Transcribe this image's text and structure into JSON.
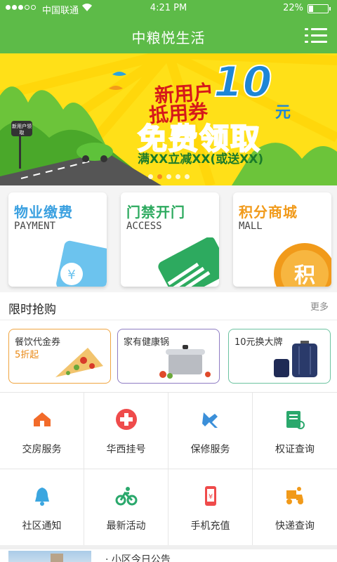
{
  "status_bar": {
    "carrier": "中国联通",
    "time": "4:21 PM",
    "battery": "22%",
    "battery_level": 0.22
  },
  "header": {
    "title": "中粮悦生活",
    "menu_icon": "menu-icon"
  },
  "banner": {
    "line1": "新用户",
    "line2": "抵用券",
    "amount": "10",
    "unit": "元",
    "big": "免费领取",
    "small": "满XX立减XX(或送XX)",
    "sign": "新用户领取",
    "dots": 5,
    "active_dot": 1
  },
  "features": [
    {
      "zh": "物业缴费",
      "en": "PAYMENT",
      "color": "#3aa0e0"
    },
    {
      "zh": "门禁开门",
      "en": "ACCESS",
      "color": "#2daa5f"
    },
    {
      "zh": "积分商城",
      "en": "MALL",
      "color": "#f19a1a"
    }
  ],
  "flash_sale": {
    "title": "限时抢购",
    "more": "更多"
  },
  "promos": [
    {
      "title": "餐饮代金券",
      "subtitle": "5折起",
      "border": "#f0a440"
    },
    {
      "title": "家有健康锅",
      "subtitle": "",
      "border": "#8e7cc3"
    },
    {
      "title": "10元换大牌",
      "subtitle": "",
      "border": "#6cc3a0"
    }
  ],
  "services": [
    {
      "label": "交房服务",
      "icon": "house-hand-icon",
      "color": "#f26b2a"
    },
    {
      "label": "华西挂号",
      "icon": "medical-cross-icon",
      "color": "#ef4b4b"
    },
    {
      "label": "保修服务",
      "icon": "wrench-hand-icon",
      "color": "#3b8fd9"
    },
    {
      "label": "权证查询",
      "icon": "document-search-icon",
      "color": "#2aa86c"
    },
    {
      "label": "社区通知",
      "icon": "bell-icon",
      "color": "#3ba6e0"
    },
    {
      "label": "最新活动",
      "icon": "bicycle-icon",
      "color": "#2aa86c"
    },
    {
      "label": "手机充值",
      "icon": "phone-yuan-icon",
      "color": "#ef4b4b"
    },
    {
      "label": "快递查询",
      "icon": "delivery-scooter-icon",
      "color": "#f19a1a"
    }
  ],
  "notice": {
    "title": "· 小区今日公告"
  }
}
